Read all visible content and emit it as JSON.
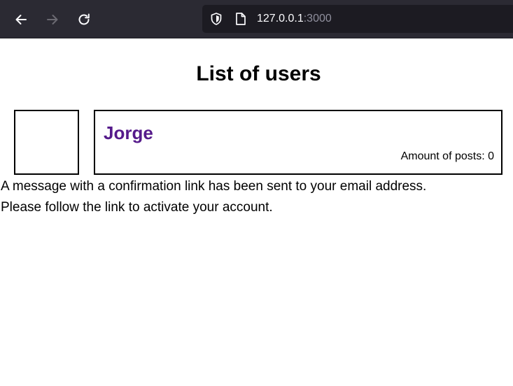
{
  "browser": {
    "url_host": "127.0.0.1",
    "url_port": ":3000",
    "icons": {
      "back": "arrow-left-icon",
      "forward": "arrow-right-icon",
      "reload": "reload-icon",
      "tracking": "shield-icon",
      "page": "page-icon"
    },
    "forward_disabled": true
  },
  "page": {
    "title": "List of users",
    "users": [
      {
        "name": "Jorge",
        "posts_label": "Amount of posts: 0"
      }
    ],
    "notice": {
      "line1": "A message with a confirmation link has been sent to your email address.",
      "line2": "Please follow the link to activate your account."
    }
  },
  "colors": {
    "toolbar": "#2b2a33",
    "urlbar": "#1c1b22",
    "link_visited": "#551a8b",
    "text": "#000000"
  }
}
